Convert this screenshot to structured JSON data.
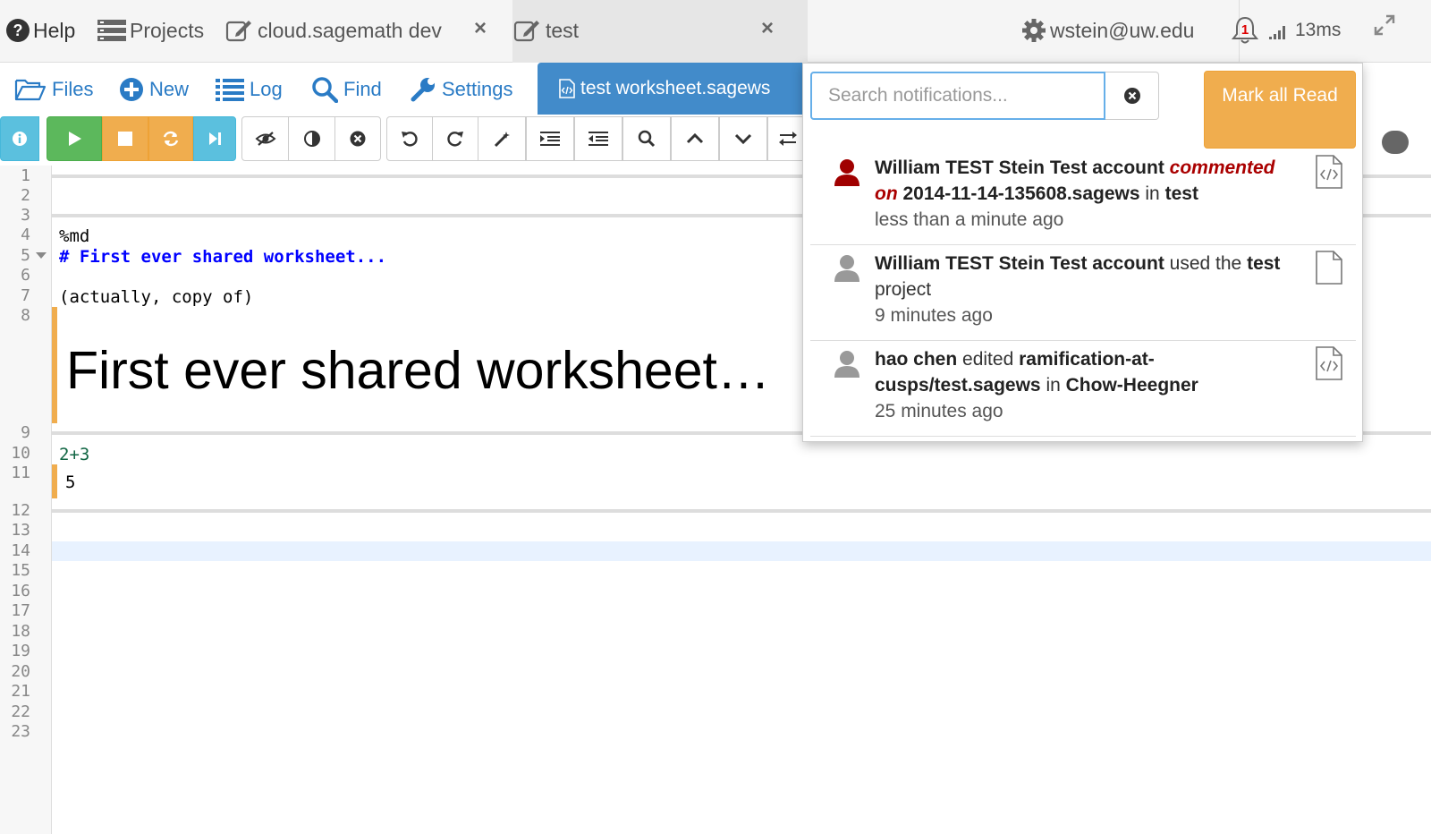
{
  "topbar": {
    "help": "Help",
    "projects": "Projects",
    "tab1": "cloud.sagemath dev",
    "tab2": "test",
    "tab_close": "×",
    "account": "wstein@uw.edu",
    "notification_count": "1",
    "ping": "13ms"
  },
  "nav": {
    "files": "Files",
    "new": "New",
    "log": "Log",
    "find": "Find",
    "settings": "Settings",
    "active_file": "test worksheet.sagews"
  },
  "editor": {
    "line_numbers": [
      "1",
      "2",
      "3",
      "4",
      "5",
      "6",
      "7",
      "8",
      "9",
      "10",
      "11",
      "12",
      "13",
      "14",
      "15",
      "16",
      "17",
      "18",
      "19",
      "20",
      "21",
      "22",
      "23"
    ],
    "code_md": "%md",
    "code_heading": "# First ever shared worksheet...",
    "code_note": "(actually, copy of)",
    "md_output": "First ever shared worksheet…",
    "code_expr": "2+3",
    "result": "5"
  },
  "notifications": {
    "search_placeholder": "Search notifications...",
    "mark_all_read": "Mark all Read",
    "items": [
      {
        "user": "William TEST Stein Test account",
        "action": "commented on",
        "target": "2014-11-14-135608.sagews",
        "in": "in",
        "project": "test",
        "time": "less than a minute ago",
        "avatar_color": "#a00000"
      },
      {
        "user": "William TEST Stein Test account",
        "action": "used the",
        "target": "test",
        "suffix": "project",
        "time": "9 minutes ago",
        "avatar_color": "#999999"
      },
      {
        "user": "hao chen",
        "action": "edited",
        "target": "ramification-at-cusps/test.sagews",
        "in": "in",
        "project": "Chow-Heegner",
        "time": "25 minutes ago",
        "avatar_color": "#999999"
      }
    ]
  },
  "colors": {
    "primary": "#428bca",
    "warning": "#f0ad4e",
    "success": "#5cb85c",
    "info": "#5bc0de"
  }
}
